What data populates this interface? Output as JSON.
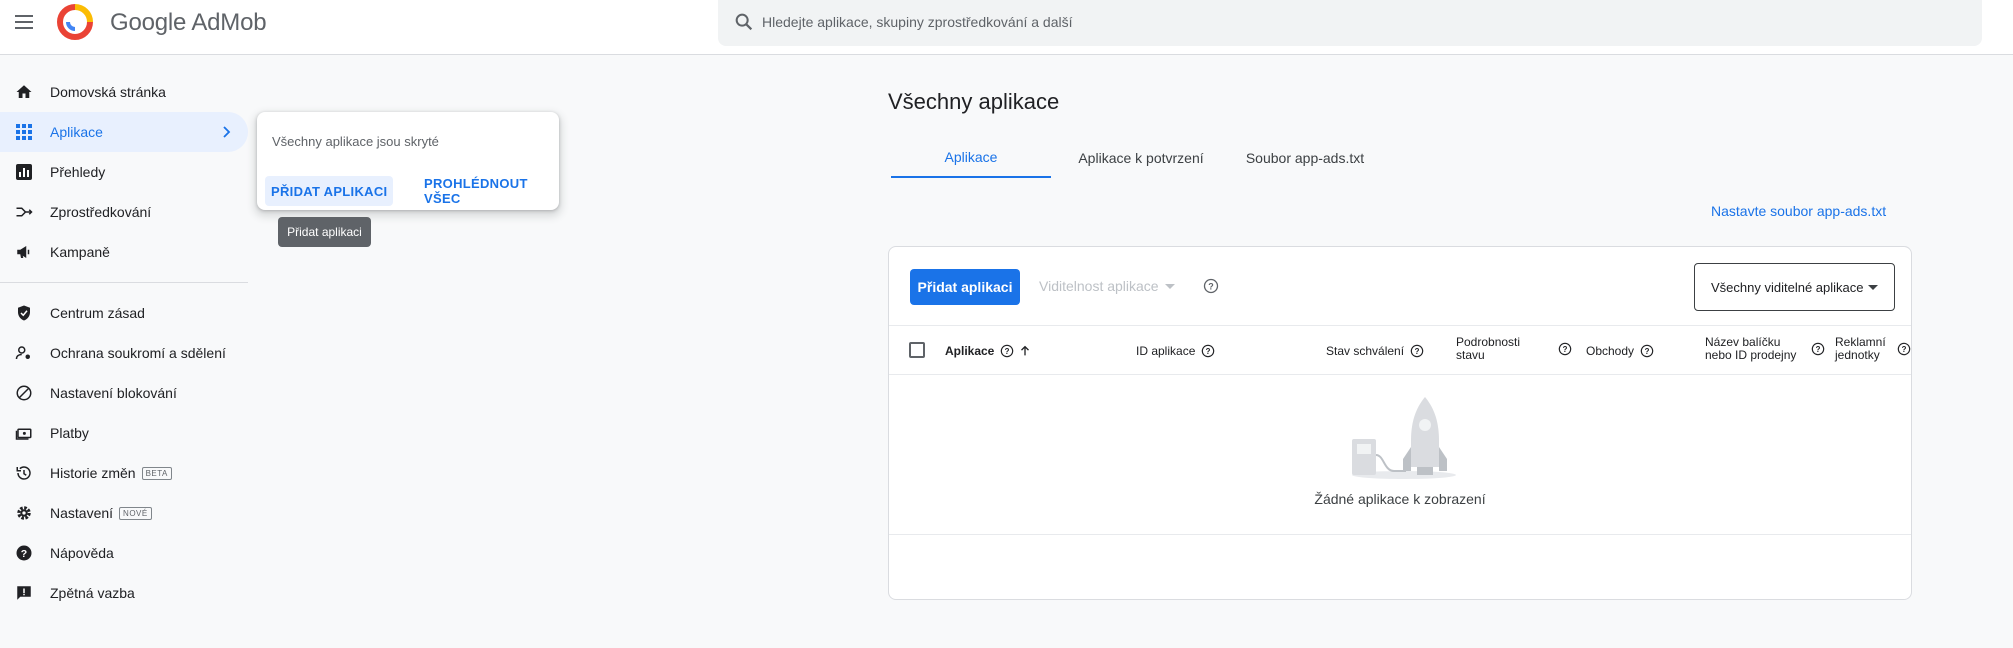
{
  "header": {
    "brand": "Google AdMob",
    "search_placeholder": "Hledejte aplikace, skupiny zprostředkování a další"
  },
  "sidebar": {
    "items": [
      {
        "label": "Domovská stránka"
      },
      {
        "label": "Aplikace"
      },
      {
        "label": "Přehledy"
      },
      {
        "label": "Zprostředkování"
      },
      {
        "label": "Kampaně"
      },
      {
        "label": "Centrum zásad"
      },
      {
        "label": "Ochrana soukromí a sdělení"
      },
      {
        "label": "Nastavení blokování"
      },
      {
        "label": "Platby"
      },
      {
        "label": "Historie změn",
        "badge": "BETA"
      },
      {
        "label": "Nastavení",
        "badge": "NOVÉ"
      },
      {
        "label": "Nápověda"
      },
      {
        "label": "Zpětná vazba"
      }
    ]
  },
  "popup": {
    "text": "Všechny aplikace jsou skryté",
    "add_label": "PŘIDAT APLIKACI",
    "view_all_label": "PROHLÉDNOUT VŠEC",
    "tooltip": "Přidat aplikaci"
  },
  "main": {
    "title": "Všechny aplikace",
    "tabs": [
      {
        "label": "Aplikace"
      },
      {
        "label": "Aplikace k potvrzení"
      },
      {
        "label": "Soubor app-ads.txt"
      }
    ],
    "ads_link": "Nastavte soubor app-ads.txt",
    "add_button": "Přidat aplikaci",
    "visibility_label": "Viditelnost aplikace",
    "filter_value": "Všechny viditelné aplikace",
    "columns": [
      {
        "label": "Aplikace"
      },
      {
        "label": "ID aplikace"
      },
      {
        "label": "Stav schválení"
      },
      {
        "label": "Podrobnosti stavu"
      },
      {
        "label": "Obchody"
      },
      {
        "label": "Název balíčku nebo ID prodejny"
      },
      {
        "label": "Reklamní jednotky"
      }
    ],
    "empty_text": "Žádné aplikace k zobrazení"
  },
  "colors": {
    "accent": "#1a73e8",
    "active_bg": "#e8f0fe"
  }
}
